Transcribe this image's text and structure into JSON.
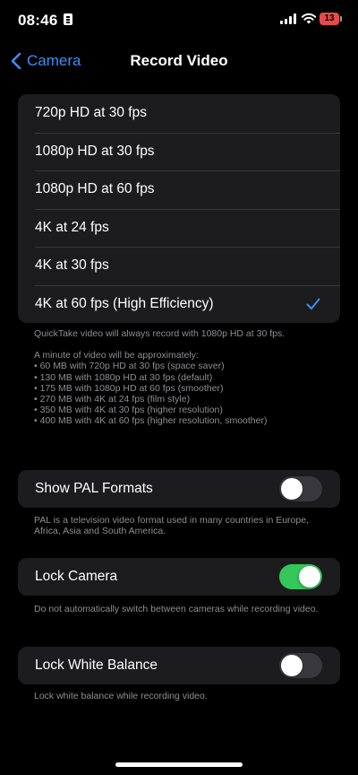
{
  "status_bar": {
    "time": "08:46",
    "battery_level": "13",
    "battery_color": "#e84a4a"
  },
  "nav": {
    "back_label": "Camera",
    "title": "Record Video",
    "accent_color": "#3b8ef5"
  },
  "formats": {
    "options": [
      {
        "label": "720p HD at 30 fps",
        "selected": false
      },
      {
        "label": "1080p HD at 30 fps",
        "selected": false
      },
      {
        "label": "1080p HD at 60 fps",
        "selected": false
      },
      {
        "label": "4K at 24 fps",
        "selected": false
      },
      {
        "label": "4K at 30 fps",
        "selected": false
      },
      {
        "label": "4K at 60 fps (High Efficiency)",
        "selected": true
      }
    ],
    "footnote_quicktake": "QuickTake video will always record with 1080p HD at 30 fps.",
    "footnote_size_intro": "A minute of video will be approximately:",
    "footnote_sizes": [
      "• 60 MB with 720p HD at 30 fps (space saver)",
      "• 130 MB with 1080p HD at 30 fps (default)",
      "• 175 MB with 1080p HD at 60 fps (smoother)",
      "• 270 MB with 4K at 24 fps (film style)",
      "• 350 MB with 4K at 30 fps (higher resolution)",
      "• 400 MB with 4K at 60 fps (higher resolution, smoother)"
    ]
  },
  "pal": {
    "label": "Show PAL Formats",
    "enabled": false,
    "footnote": "PAL is a television video format used in many countries in Europe, Africa, Asia and South America."
  },
  "lock_camera": {
    "label": "Lock Camera",
    "enabled": true,
    "footnote": "Do not automatically switch between cameras while recording video."
  },
  "lock_white_balance": {
    "label": "Lock White Balance",
    "enabled": false,
    "footnote": "Lock white balance while recording video."
  },
  "colors": {
    "background": "#000000",
    "group_background": "#1c1c1e",
    "toggle_on": "#34c759",
    "toggle_off": "#39393d",
    "footnote_text": "#8e8e93"
  }
}
